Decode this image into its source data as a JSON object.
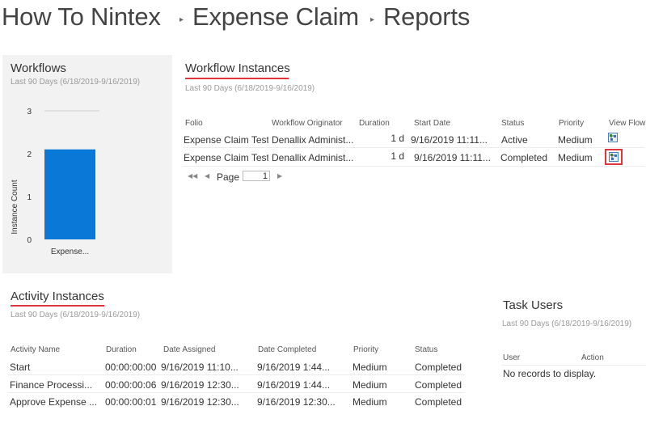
{
  "breadcrumb": {
    "items": [
      "How To Nintex",
      "Expense Claim",
      "Reports"
    ],
    "separator_icon": "triangle-right-icon"
  },
  "workflows": {
    "title": "Workflows",
    "subtitle": "Last 90 Days (6/18/2019-9/16/2019)"
  },
  "chart_data": {
    "type": "bar",
    "categories": [
      "Expense..."
    ],
    "values": [
      2.1
    ],
    "ylabel": "Instance Count",
    "ylim": [
      0,
      3
    ],
    "yticks": [
      "0",
      "1",
      "2",
      "3"
    ],
    "bar_color": "#0a78d6"
  },
  "workflow_instances": {
    "title": "Workflow Instances",
    "subtitle": "Last 90 Days (6/18/2019-9/16/2019)",
    "columns": [
      "Folio",
      "Workflow Originator",
      "Duration",
      "Start Date",
      "Status",
      "Priority",
      "View Flow"
    ],
    "rows": [
      {
        "folio": "Expense Claim Test",
        "originator": "Denallix Administ...",
        "duration": "1 d",
        "start": "9/16/2019 11:11...",
        "status": "Active",
        "priority": "Medium",
        "view_icon": "view-flow-icon"
      },
      {
        "folio": "Expense Claim Test",
        "originator": "Denallix Administ...",
        "duration": "1 d",
        "start": "9/16/2019 11:11...",
        "status": "Completed",
        "priority": "Medium",
        "view_icon": "view-flow-icon"
      }
    ],
    "pager": {
      "label": "Page",
      "page": "1"
    }
  },
  "activity_instances": {
    "title": "Activity Instances",
    "subtitle": "Last 90 Days (6/18/2019-9/16/2019)",
    "columns": [
      "Activity Name",
      "Duration",
      "Date Assigned",
      "Date Completed",
      "Priority",
      "Status"
    ],
    "rows": [
      {
        "name": "Start",
        "duration": "00:00:00:00",
        "assigned": "9/16/2019 11:10...",
        "completed": "9/16/2019 1:44...",
        "priority": "Medium",
        "status": "Completed"
      },
      {
        "name": "Finance Processi...",
        "duration": "00:00:00:06",
        "assigned": "9/16/2019 12:30...",
        "completed": "9/16/2019 1:44...",
        "priority": "Medium",
        "status": "Completed"
      },
      {
        "name": "Approve Expense ...",
        "duration": "00:00:00:01",
        "assigned": "9/16/2019 12:30...",
        "completed": "9/16/2019 12:30...",
        "priority": "Medium",
        "status": "Completed"
      }
    ]
  },
  "task_users": {
    "title": "Task Users",
    "subtitle": "Last 90 Days (6/18/2019-9/16/2019)",
    "columns": [
      "User",
      "Action"
    ],
    "empty_text": "No records to display."
  }
}
